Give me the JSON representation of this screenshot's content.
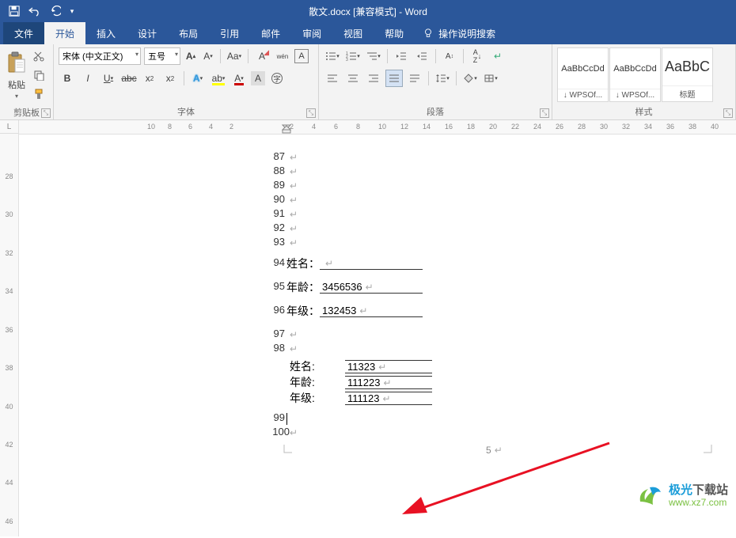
{
  "titlebar": {
    "title": "散文.docx [兼容模式] - Word"
  },
  "tabs": {
    "file": "文件",
    "home": "开始",
    "insert": "插入",
    "design": "设计",
    "layout": "布局",
    "references": "引用",
    "mailings": "邮件",
    "review": "审阅",
    "view": "视图",
    "help": "帮助",
    "tell_me": "操作说明搜索"
  },
  "ribbon": {
    "clipboard": {
      "paste": "粘贴",
      "label": "剪贴板"
    },
    "font": {
      "name": "宋体 (中文正文)",
      "size": "五号",
      "phonetic": "wén",
      "label": "字体"
    },
    "paragraph": {
      "label": "段落"
    },
    "styles": {
      "label": "样式",
      "items": [
        {
          "preview": "AaBbCcDd",
          "name": "↓ WPSOf..."
        },
        {
          "preview": "AaBbCcDd",
          "name": "↓ WPSOf..."
        },
        {
          "preview": "AaBbC",
          "name": "标题"
        }
      ]
    }
  },
  "ruler_h": [
    10,
    8,
    6,
    4,
    2,
    null,
    2,
    4,
    6,
    8,
    10,
    12,
    14,
    16,
    18,
    20,
    22,
    24,
    26,
    28,
    30,
    32,
    34,
    36,
    38,
    40
  ],
  "ruler_v": [
    "L",
    "",
    "",
    "28",
    "",
    "30",
    "",
    "32",
    "",
    "34",
    "",
    "36",
    "",
    "38",
    "",
    "40",
    "",
    "42",
    "",
    "44",
    "",
    "46"
  ],
  "doc": {
    "lines": [
      {
        "n": "87",
        "t": ""
      },
      {
        "n": "88",
        "t": ""
      },
      {
        "n": "89",
        "t": ""
      },
      {
        "n": "90",
        "t": ""
      },
      {
        "n": "91",
        "t": ""
      },
      {
        "n": "92",
        "t": ""
      },
      {
        "n": "93",
        "t": ""
      }
    ],
    "form1": [
      {
        "n": "94",
        "label": "姓名：",
        "value": ""
      },
      {
        "n": "95",
        "label": "年龄：",
        "value": "3456536"
      },
      {
        "n": "96",
        "label": "年级：",
        "value": "132453"
      }
    ],
    "mid": [
      {
        "n": "97",
        "t": ""
      },
      {
        "n": "98",
        "t": ""
      }
    ],
    "form2": [
      {
        "label": "姓名:",
        "value": "11323"
      },
      {
        "label": "年龄:",
        "value": "111223"
      },
      {
        "label": "年级:",
        "value": "111123"
      }
    ],
    "tail": [
      {
        "n": "99"
      },
      {
        "n": "100"
      }
    ],
    "page_col": "5"
  },
  "watermark": {
    "brand": "极光下载站",
    "url": "www.xz7.com"
  }
}
